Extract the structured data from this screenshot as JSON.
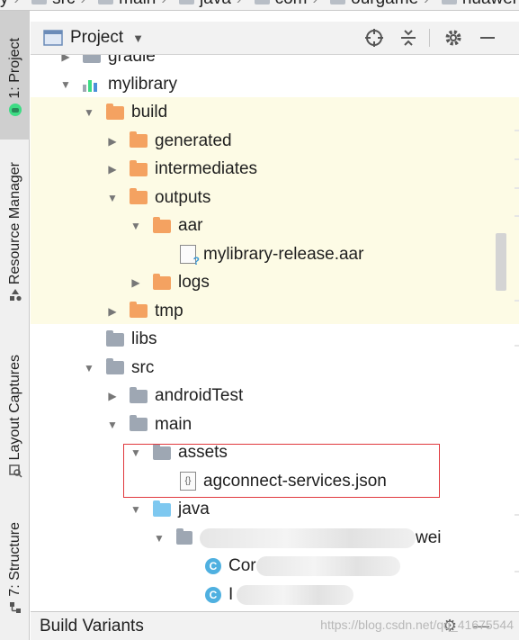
{
  "breadcrumb": [
    "y",
    "src",
    "main",
    "java",
    "com",
    "ourgame",
    "huawei"
  ],
  "side_tabs": {
    "project": "1: Project",
    "resource_manager": "Resource Manager",
    "layout_captures": "Layout Captures",
    "structure": "7: Structure"
  },
  "project_header": {
    "title": "Project",
    "icons": [
      "crosshair-icon",
      "collapse-all-icon",
      "gear-icon",
      "minimize-icon"
    ]
  },
  "tree": [
    {
      "label": "gradle",
      "icon": "folder-gray",
      "arrow": "collapsed"
    },
    {
      "label": "mylibrary",
      "icon": "module-icon",
      "arrow": "expanded"
    },
    {
      "label": "build",
      "icon": "folder-orange",
      "arrow": "expanded"
    },
    {
      "label": "generated",
      "icon": "folder-orange",
      "arrow": "collapsed"
    },
    {
      "label": "intermediates",
      "icon": "folder-orange",
      "arrow": "collapsed"
    },
    {
      "label": "outputs",
      "icon": "folder-orange",
      "arrow": "expanded"
    },
    {
      "label": "aar",
      "icon": "folder-orange",
      "arrow": "expanded"
    },
    {
      "label": "mylibrary-release.aar",
      "icon": "unknown-file-icon",
      "arrow": "none"
    },
    {
      "label": "logs",
      "icon": "folder-orange",
      "arrow": "collapsed"
    },
    {
      "label": "tmp",
      "icon": "folder-orange",
      "arrow": "collapsed"
    },
    {
      "label": "libs",
      "icon": "folder-gray",
      "arrow": "none"
    },
    {
      "label": "src",
      "icon": "folder-gray",
      "arrow": "expanded"
    },
    {
      "label": "androidTest",
      "icon": "folder-gray",
      "arrow": "collapsed"
    },
    {
      "label": "main",
      "icon": "folder-gray",
      "arrow": "expanded"
    },
    {
      "label": "assets",
      "icon": "assets-folder-icon",
      "arrow": "expanded"
    },
    {
      "label": "agconnect-services.json",
      "icon": "json-file-icon",
      "arrow": "none"
    },
    {
      "label": "java",
      "icon": "folder-blue",
      "arrow": "expanded"
    },
    {
      "label": "wei",
      "icon": "package-icon",
      "arrow": "expanded"
    },
    {
      "label": "Cor",
      "icon": "class-icon",
      "arrow": "none"
    },
    {
      "label": "I",
      "icon": "class-icon",
      "arrow": "none"
    }
  ],
  "bottom": {
    "build_variants": "Build Variants",
    "watermark": "https://blog.csdn.net/qq_41675544"
  },
  "colors": {
    "highlight_band": "#fdfbe5",
    "orange_folder": "#f4a261",
    "blue_folder": "#7ec8f0",
    "red_box": "#e0393e"
  }
}
